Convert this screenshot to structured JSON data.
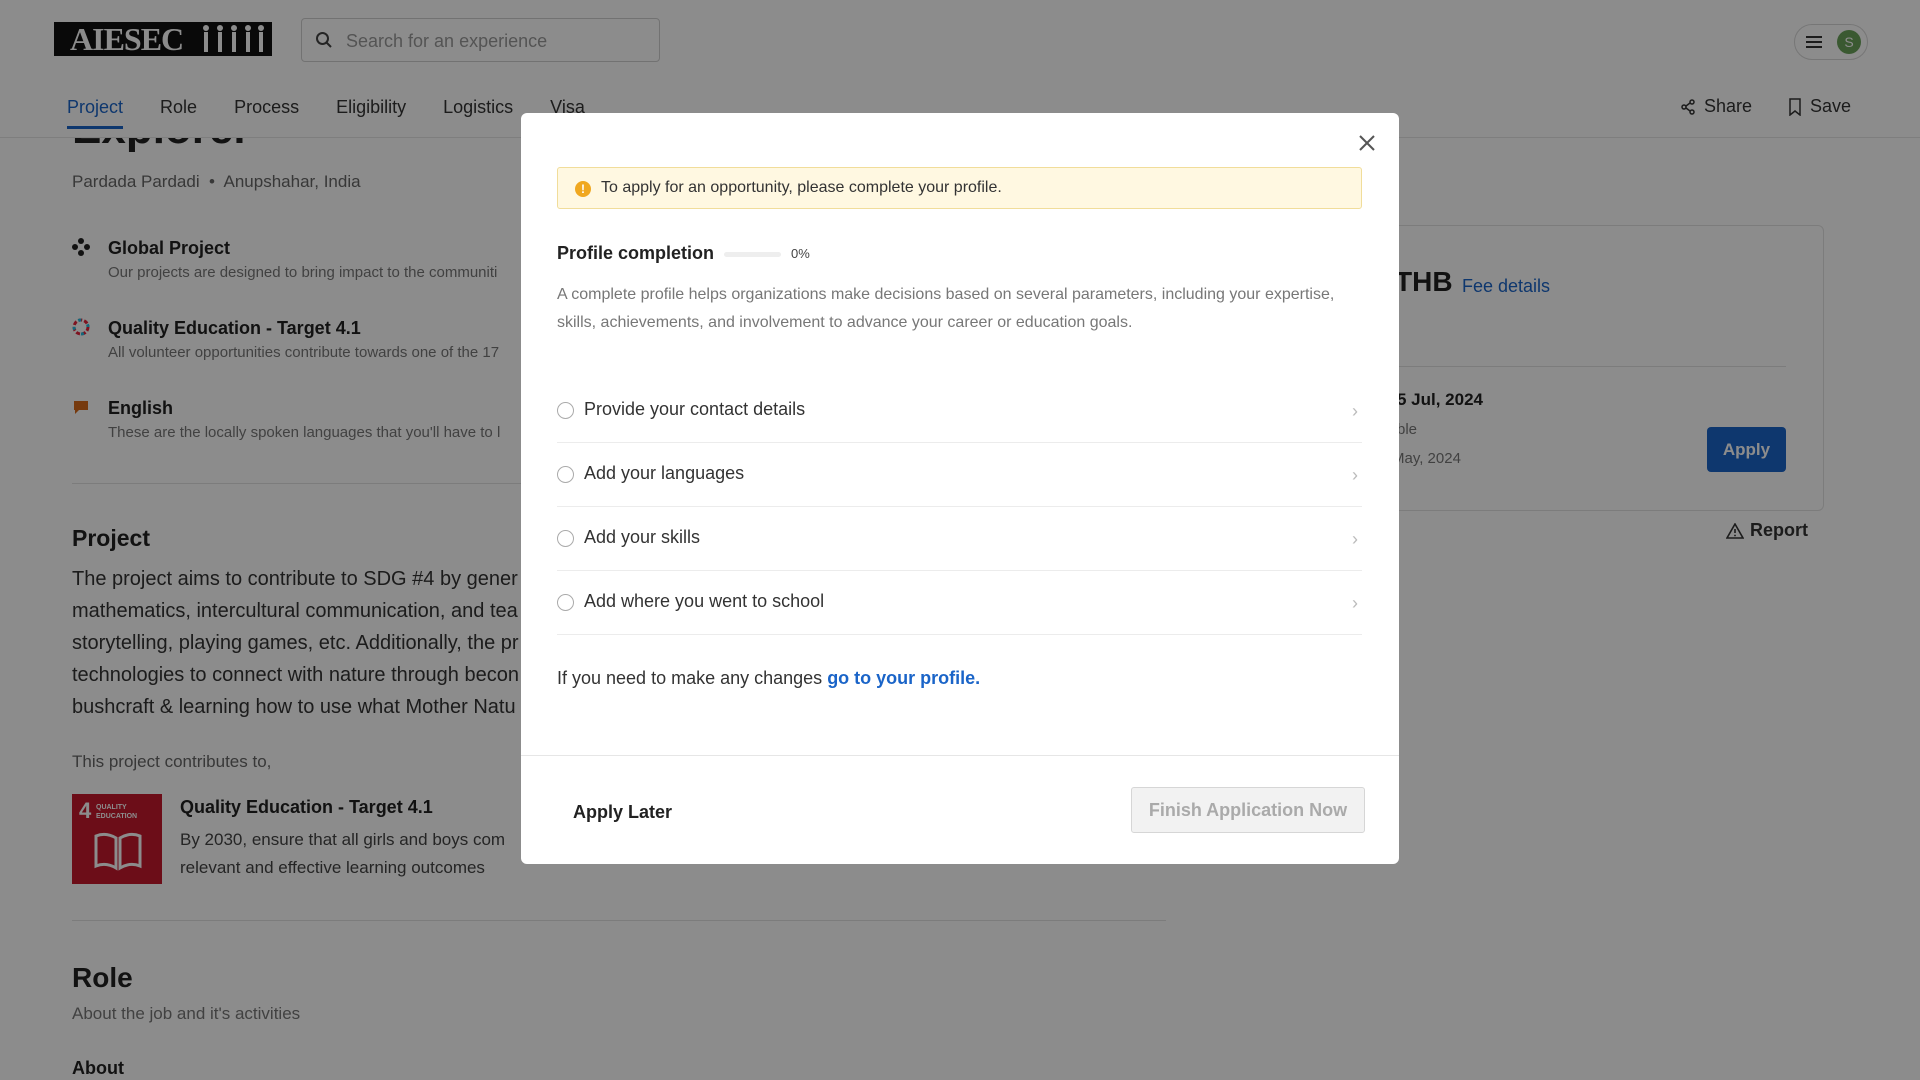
{
  "header": {
    "logo_text": "AIESEC",
    "search_placeholder": "Search for an experience",
    "avatar_initial": "S",
    "tabs": [
      "Project",
      "Role",
      "Process",
      "Eligibility",
      "Logistics",
      "Visa"
    ],
    "share_label": "Share",
    "save_label": "Save"
  },
  "page": {
    "title_partial": "Explorer",
    "org": "Pardada Pardadi",
    "location": "Anupshahar, India",
    "features": [
      {
        "title": "Global Project",
        "desc": "Our projects are designed to bring impact to the communiti"
      },
      {
        "title": "Quality Education - Target 4.1",
        "desc": "All volunteer opportunities contribute towards one of the 17"
      },
      {
        "title": "English",
        "desc": "These are the locally spoken languages that you'll have to l"
      }
    ],
    "project_heading": "Project",
    "project_lines": [
      "The project aims to contribute to SDG #4 by gener",
      "mathematics, intercultural communication, and tea",
      "storytelling, playing games, etc. Additionally, the pr",
      "technologies to connect with nature through becon",
      "bushcraft & learning how to use what Mother Natu"
    ],
    "contributes_label": "This project contributes to,",
    "sdg_number": "4",
    "sdg_tile_text": "QUALITY EDUCATION",
    "sdg_title": "Quality Education - Target 4.1",
    "sdg_desc_lines": [
      "By 2030, ensure that all girls and boys com",
      "relevant and effective learning outcomes"
    ],
    "role_heading": "Role",
    "role_sub": "About the job and it's activities",
    "about_heading": "About",
    "card": {
      "currency": "THB",
      "fee_link": "Fee details",
      "date": "5 Jul, 2024",
      "line2": "ble",
      "line3": "May, 2024",
      "apply_label": "Apply"
    },
    "report_label": "Report"
  },
  "modal": {
    "alert_text": "To apply for an opportunity, please complete your profile.",
    "completion_title": "Profile completion",
    "completion_pct": "0%",
    "completion_value": 0,
    "description": "A complete profile helps organizations make decisions based on several parameters, including your expertise, skills, achievements, and involvement to advance your career or education goals.",
    "steps": [
      "Provide your contact details",
      "Add your languages",
      "Add your skills",
      "Add where you went to school"
    ],
    "profile_prefix": "If you need to make any changes ",
    "profile_link": "go to your profile.",
    "later_label": "Apply Later",
    "finish_label": "Finish Application Now"
  }
}
